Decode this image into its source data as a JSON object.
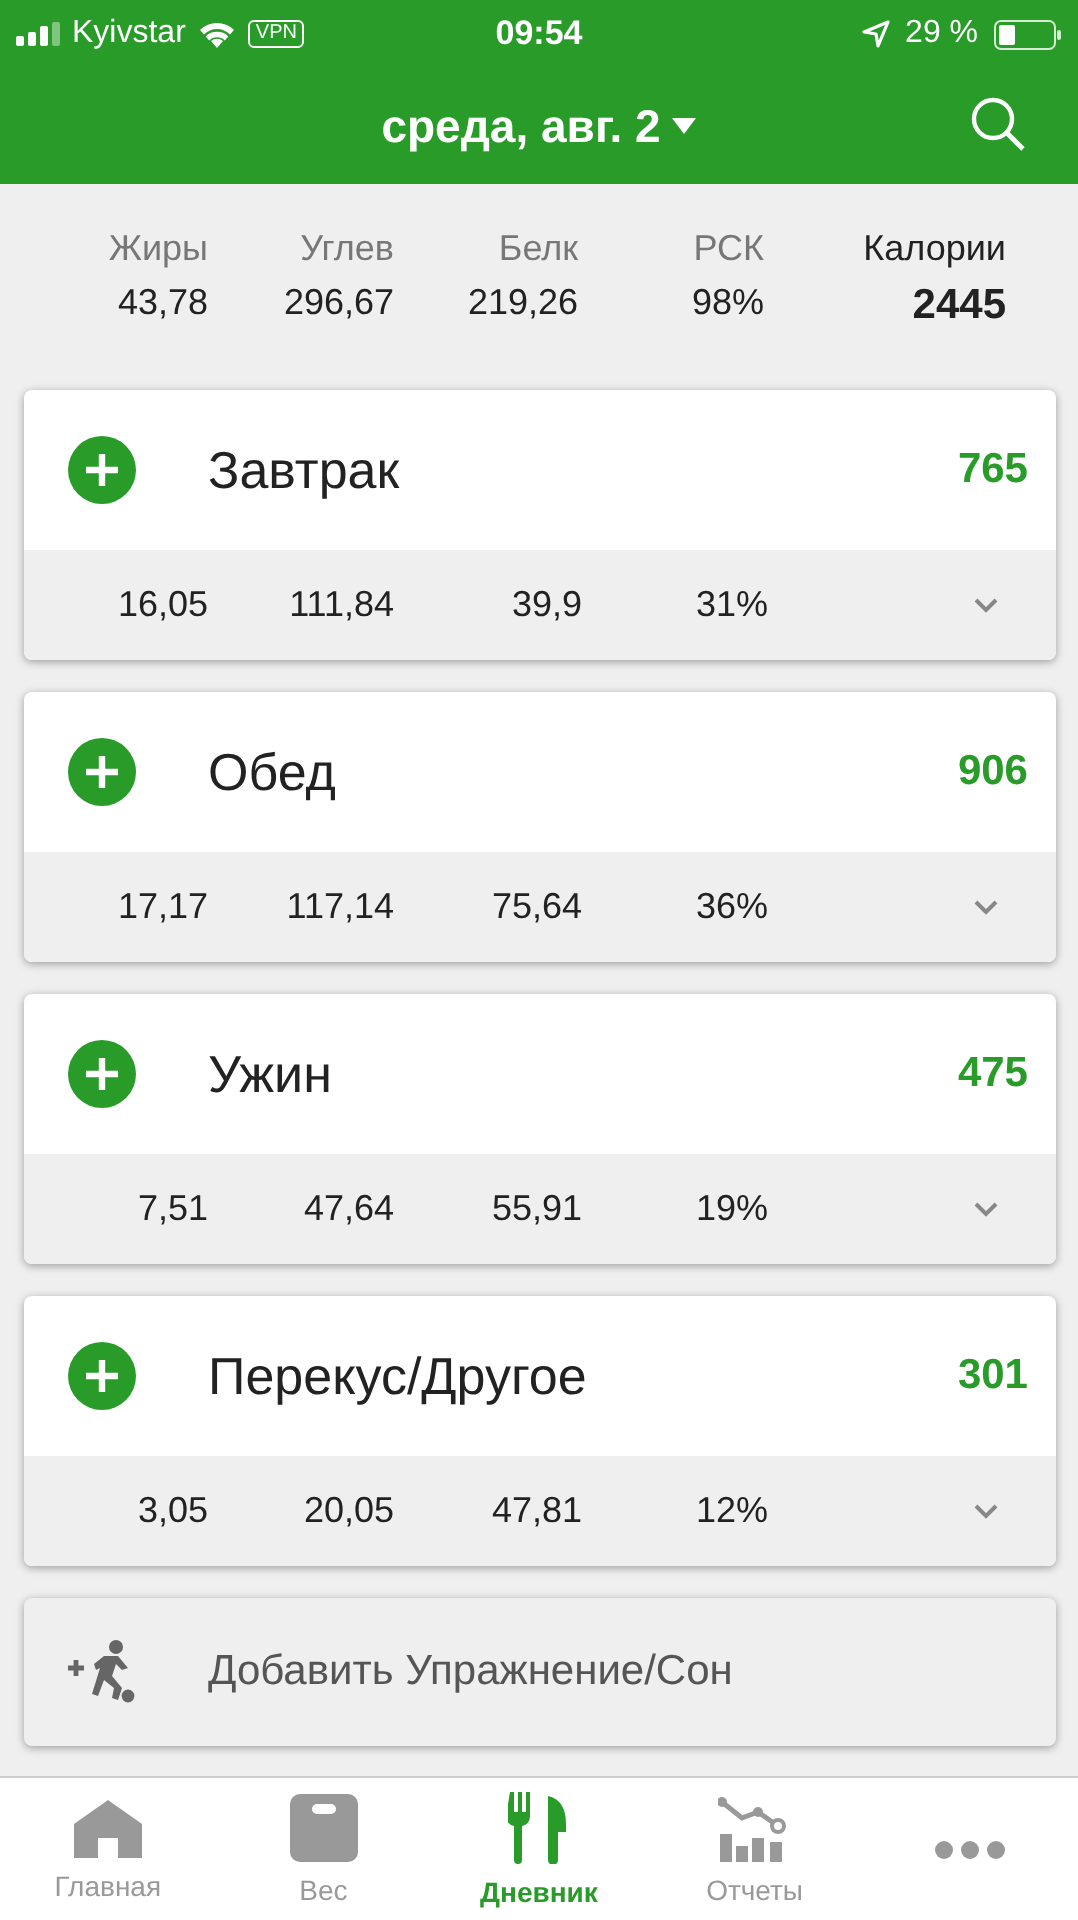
{
  "status_bar": {
    "carrier": "Kyivstar",
    "vpn": "VPN",
    "time": "09:54",
    "battery": "29 %"
  },
  "header": {
    "title": "среда, авг. 2"
  },
  "summary": [
    {
      "label": "Жиры",
      "value": "43,78",
      "kind": "macro"
    },
    {
      "label": "Углев",
      "value": "296,67",
      "kind": "macro"
    },
    {
      "label": "Белк",
      "value": "219,26",
      "kind": "macro"
    },
    {
      "label": "РСК",
      "value": "98%",
      "kind": "macro"
    },
    {
      "label": "Калории",
      "value": "2445",
      "kind": "total"
    }
  ],
  "meals": [
    {
      "name": "Завтрак",
      "calories": "765",
      "values": [
        "16,05",
        "111,84",
        "39,9",
        "31%"
      ]
    },
    {
      "name": "Обед",
      "calories": "906",
      "values": [
        "17,17",
        "117,14",
        "75,64",
        "36%"
      ]
    },
    {
      "name": "Ужин",
      "calories": "475",
      "values": [
        "7,51",
        "47,64",
        "55,91",
        "19%"
      ]
    },
    {
      "name": "Перекус/Другое",
      "calories": "301",
      "values": [
        "3,05",
        "20,05",
        "47,81",
        "12%"
      ]
    }
  ],
  "exercise": {
    "label": "Добавить Упражнение/Сон"
  },
  "nav": [
    {
      "label": "Главная",
      "selected": false
    },
    {
      "label": "Вес",
      "selected": false
    },
    {
      "label": "Дневник",
      "selected": true
    },
    {
      "label": "Отчеты",
      "selected": false
    },
    {
      "selected": false
    }
  ]
}
